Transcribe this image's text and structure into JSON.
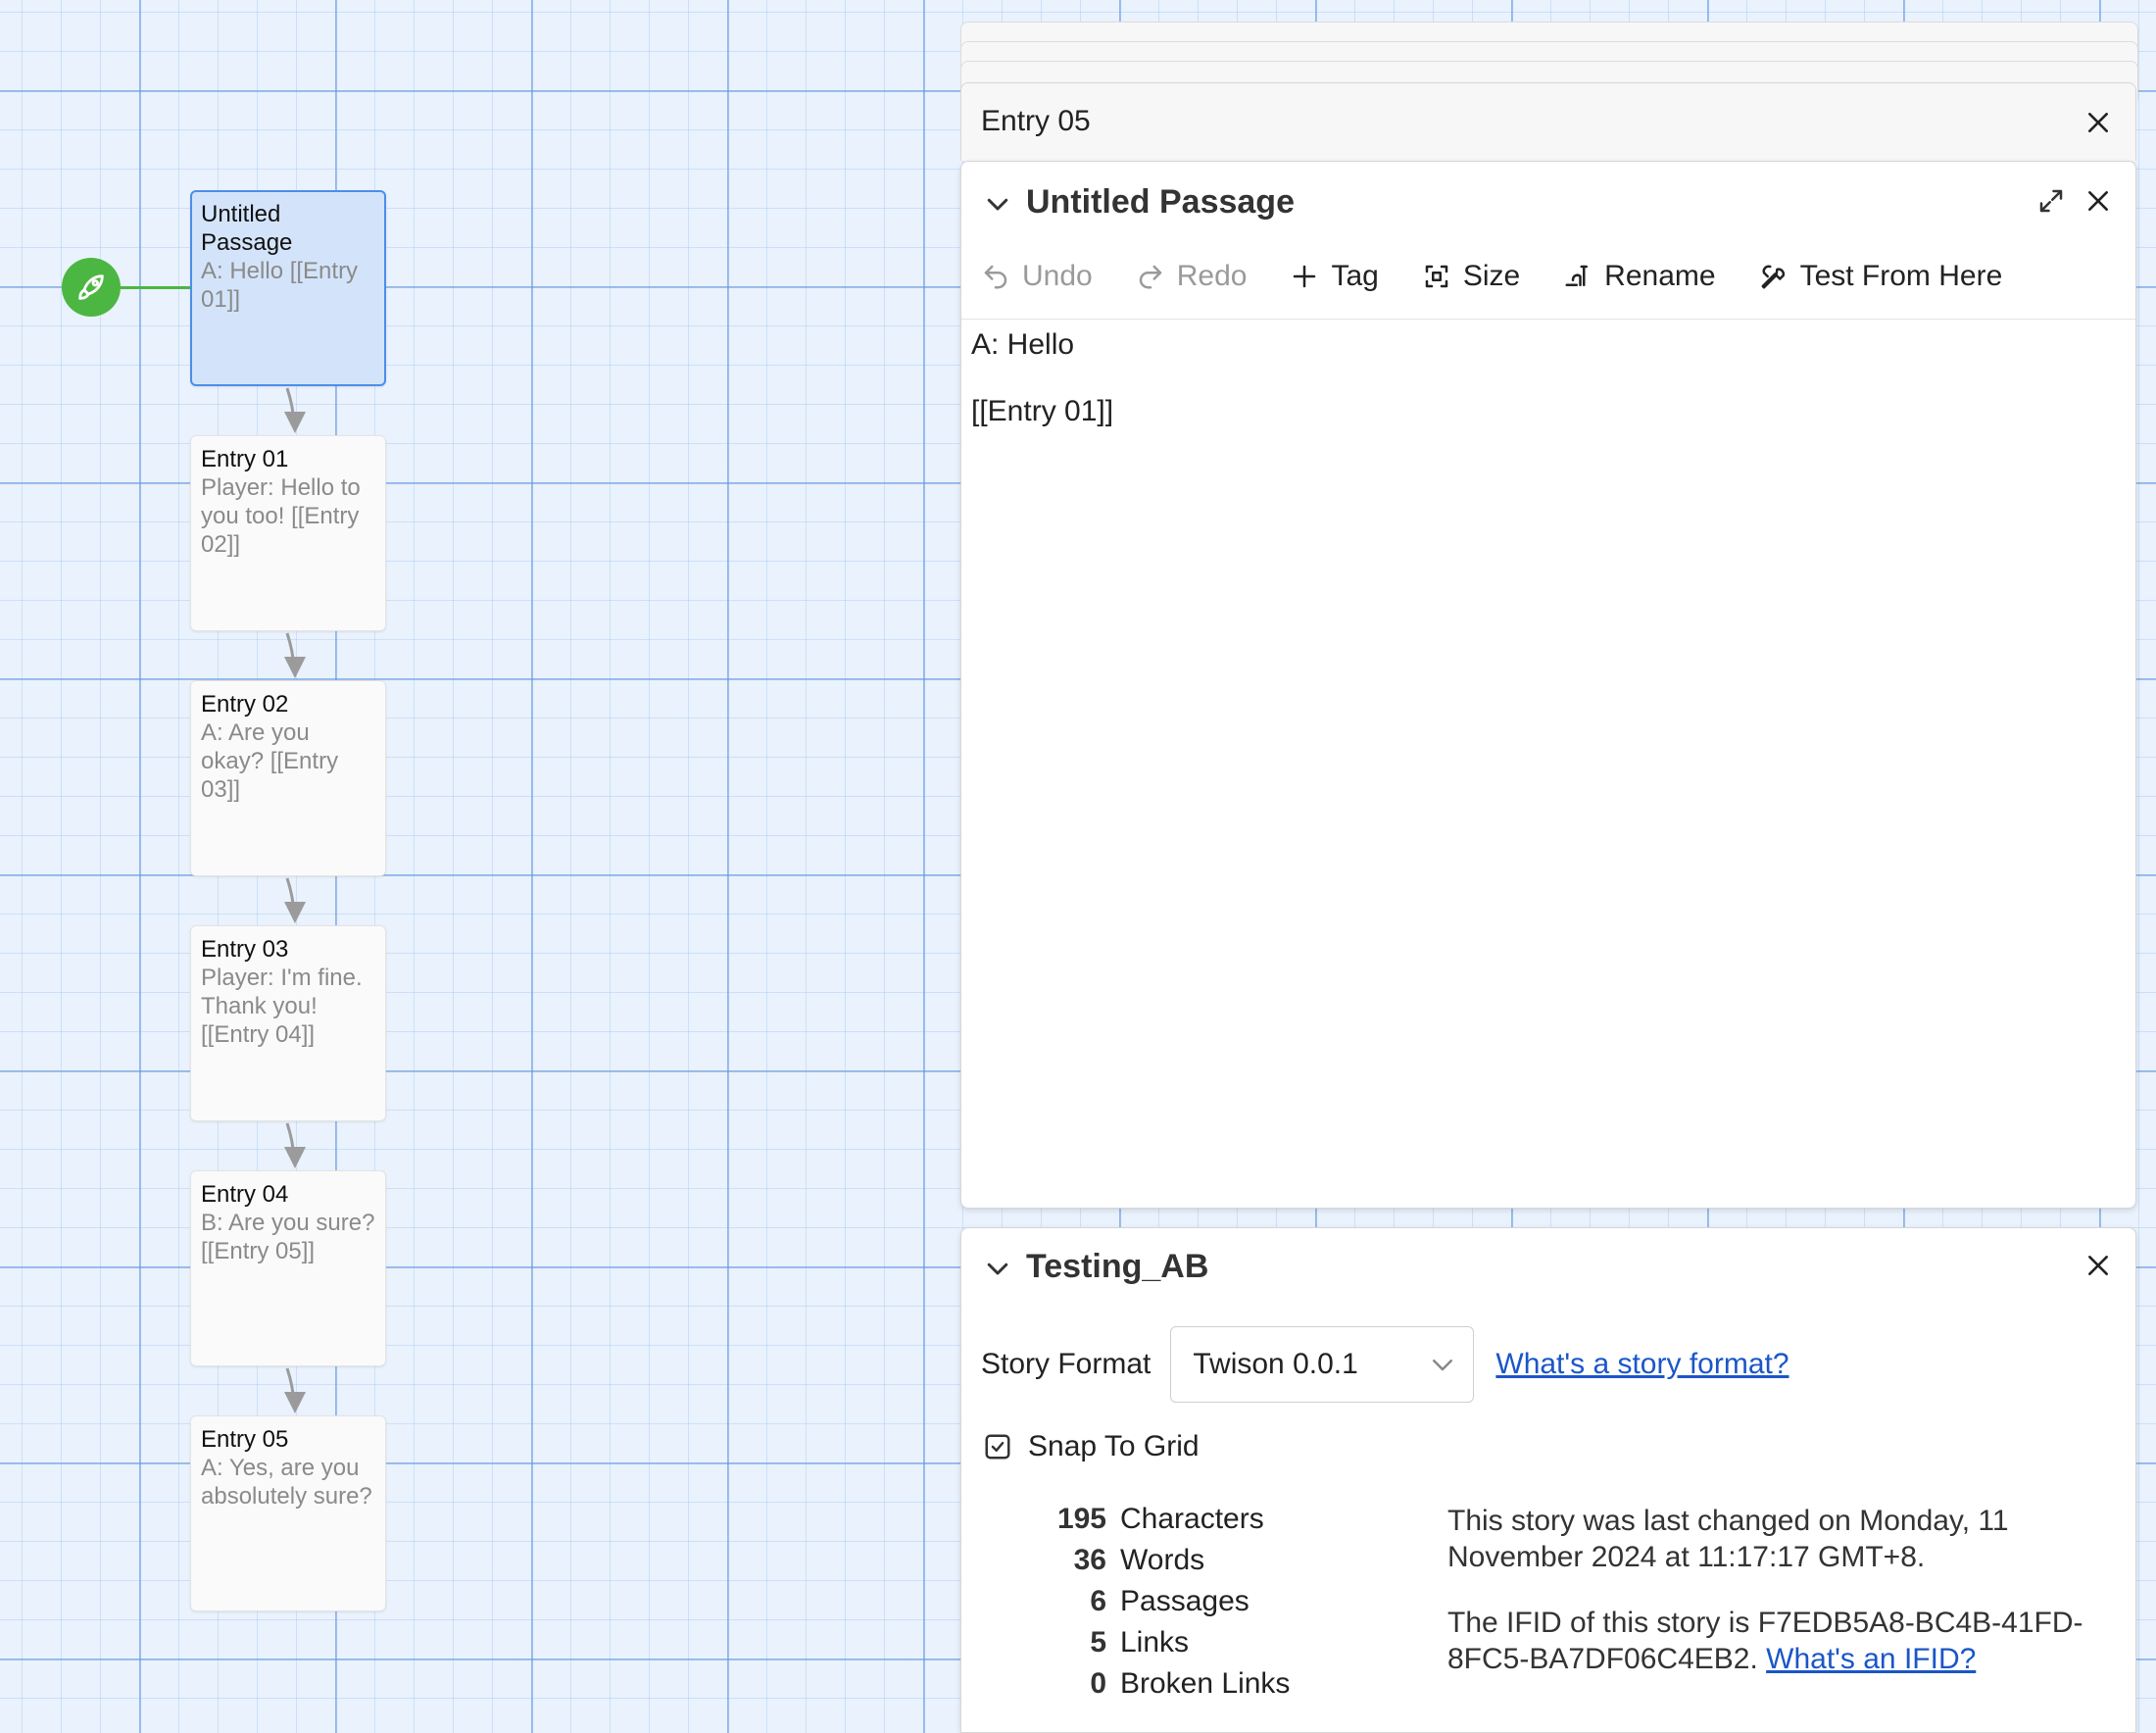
{
  "story_map": {
    "passages": [
      {
        "name": "Untitled Passage",
        "excerpt": "A: Hello [[Entry 01]]",
        "selected": true
      },
      {
        "name": "Entry 01",
        "excerpt": "Player: Hello to you too! [[Entry 02]]",
        "selected": false
      },
      {
        "name": "Entry 02",
        "excerpt": "A: Are you okay? [[Entry 03]]",
        "selected": false
      },
      {
        "name": "Entry 03",
        "excerpt": "Player: I'm fine. Thank you! [[Entry 04]]",
        "selected": false
      },
      {
        "name": "Entry 04",
        "excerpt": "B: Are you sure? [[Entry 05]]",
        "selected": false
      },
      {
        "name": "Entry 05",
        "excerpt": "A: Yes, are you absolutely sure?",
        "selected": false
      }
    ],
    "start_icon": "rocket-icon",
    "colors": {
      "start": "#4cb642",
      "selected_border": "#4d8ee8",
      "link_arrow": "#9b9b9b"
    }
  },
  "collapsed_dialog": {
    "title": "Entry 05"
  },
  "passage_dialog": {
    "title": "Untitled Passage",
    "toolbar": {
      "undo": "Undo",
      "redo": "Redo",
      "tag": "Tag",
      "size": "Size",
      "rename": "Rename",
      "test": "Test From Here"
    },
    "text": [
      "A: Hello",
      "[[Entry 01]]"
    ]
  },
  "details_dialog": {
    "title": "Testing_AB",
    "story_format_label": "Story Format",
    "story_format_value": "Twison 0.0.1",
    "story_format_help": "What's a story format?",
    "snap_to_grid": "Snap To Grid",
    "stats": [
      {
        "count": "195",
        "label": "Characters"
      },
      {
        "count": "36",
        "label": "Words"
      },
      {
        "count": "6",
        "label": "Passages"
      },
      {
        "count": "5",
        "label": "Links"
      },
      {
        "count": "0",
        "label": "Broken Links"
      }
    ],
    "last_changed": "This story was last changed on Monday, 11 November 2024 at 11:17:17 GMT+8.",
    "ifid_text": "The IFID of this story is F7EDB5A8-BC4B-41FD-8FC5-BA7DF06C4EB2.",
    "ifid_help": "What's an IFID?"
  }
}
